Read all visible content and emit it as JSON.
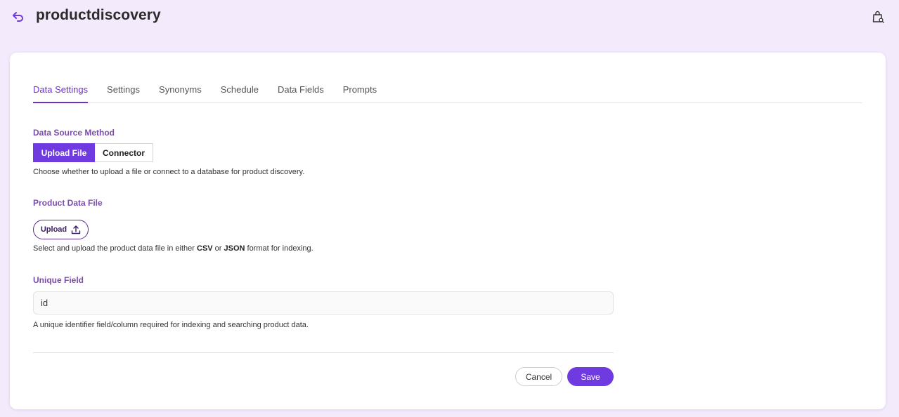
{
  "header": {
    "title": "productdiscovery",
    "back_icon": "back-arrow-icon",
    "bag_icon": "shopping-bag-search-icon"
  },
  "tabs": [
    {
      "label": "Data Settings",
      "active": true
    },
    {
      "label": "Settings",
      "active": false
    },
    {
      "label": "Synonyms",
      "active": false
    },
    {
      "label": "Schedule",
      "active": false
    },
    {
      "label": "Data Fields",
      "active": false
    },
    {
      "label": "Prompts",
      "active": false
    }
  ],
  "data_source": {
    "label": "Data Source Method",
    "options": [
      "Upload File",
      "Connector"
    ],
    "selected": "Upload File",
    "help": "Choose whether to upload a file or connect to a database for product discovery."
  },
  "product_file": {
    "label": "Product Data File",
    "button_label": "Upload",
    "help_prefix": "Select and upload the product data file in either ",
    "help_csv": "CSV",
    "help_mid": " or ",
    "help_json": "JSON",
    "help_suffix": " format for indexing."
  },
  "unique_field": {
    "label": "Unique Field",
    "value": "id",
    "help": "A unique identifier field/column required for indexing and searching product data."
  },
  "actions": {
    "cancel_label": "Cancel",
    "save_label": "Save"
  },
  "colors": {
    "accent": "#6f3ae0",
    "tab_active": "#6d2ed6",
    "section_label": "#7a4cae",
    "background": "#f3eafc"
  }
}
